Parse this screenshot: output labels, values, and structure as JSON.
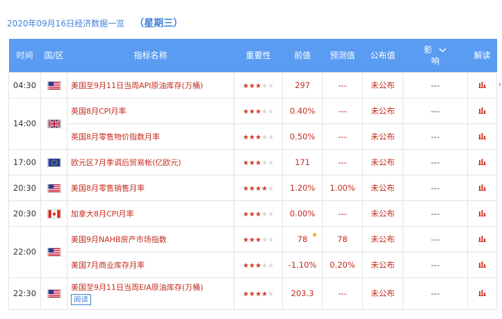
{
  "header": {
    "title": "2020年09月16日经济数据一览",
    "weekday": "（星期三）"
  },
  "columns": {
    "time": "时间",
    "country": "国/区",
    "indicator": "指标名称",
    "importance": "重要性",
    "previous": "前值",
    "forecast": "预测值",
    "actual": "公布值",
    "impact_top": "影",
    "impact_bottom": "响",
    "interpret": "解读"
  },
  "colors": {
    "header_bg": "#5a9cf1",
    "accent_red": "#c42b1c",
    "star_on": "#d03b2a",
    "link_blue": "#3f7fd8"
  },
  "rows": [
    {
      "time": "04:30",
      "flag": "us-flag",
      "indicator": "美国至9月11日当周API原油库存(万桶)",
      "stars": 3,
      "previous": "297",
      "forecast": "---",
      "actual": "未公布",
      "impact": "---"
    },
    {
      "time": "14:00",
      "flag": "uk-flag",
      "indicator": "英国8月CPI月率",
      "stars": 3,
      "previous": "0.40%",
      "forecast": "---",
      "actual": "未公布",
      "impact": "---"
    },
    {
      "time": "",
      "flag": "",
      "indicator": "英国8月零售物价指数月率",
      "stars": 3,
      "previous": "0.50%",
      "forecast": "---",
      "actual": "未公布",
      "impact": "---"
    },
    {
      "time": "17:00",
      "flag": "eu-flag",
      "indicator": "欧元区7月季调后贸易帐(亿欧元)",
      "stars": 3,
      "previous": "171",
      "forecast": "---",
      "actual": "未公布",
      "impact": "---"
    },
    {
      "time": "20:30",
      "flag": "us-flag",
      "indicator": "美国8月零售销售月率",
      "stars": 4,
      "previous": "1.20%",
      "forecast": "1.00%",
      "actual": "未公布",
      "impact": "---"
    },
    {
      "time": "20:30",
      "flag": "ca-flag",
      "indicator": "加拿大8月CPI月率",
      "stars": 3,
      "previous": "0.00%",
      "forecast": "---",
      "actual": "未公布",
      "impact": "---"
    },
    {
      "time": "22:00",
      "flag": "us-flag",
      "indicator": "美国9月NAHB房产市场指数",
      "stars": 3,
      "previous": "78",
      "forecast": "78",
      "actual": "未公布",
      "impact": "---"
    },
    {
      "time": "",
      "flag": "",
      "indicator": "美国7月商业库存月率",
      "stars": 3,
      "previous": "-1.10%",
      "forecast": "0.20%",
      "actual": "未公布",
      "impact": "---"
    },
    {
      "time": "22:30",
      "flag": "us-flag",
      "indicator": "美国至9月11日当周EIA原油库存(万桶)",
      "read_label": "阅读",
      "stars": 4,
      "previous": "203.3",
      "forecast": "---",
      "actual": "未公布",
      "impact": "---"
    }
  ]
}
